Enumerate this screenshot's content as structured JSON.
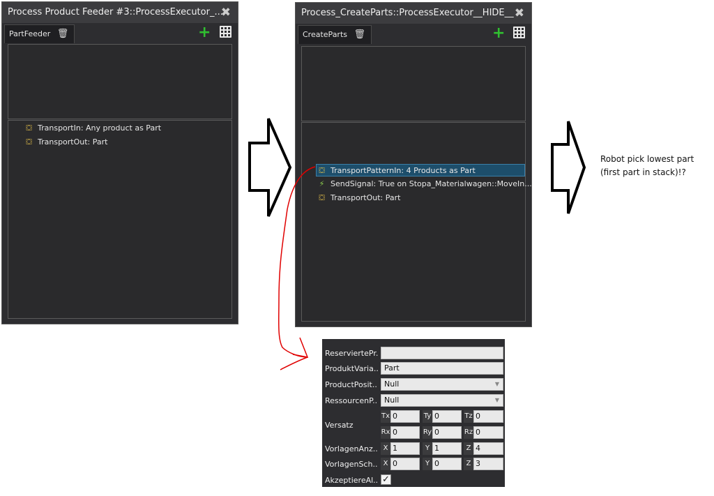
{
  "left_window": {
    "title": "Process Product Feeder #3::ProcessExecutor_...",
    "close": "✖",
    "tab": "PartFeeder",
    "items": [
      {
        "icon": "⛋",
        "label": "TransportIn: Any product as Part"
      },
      {
        "icon": "⛋",
        "label": "TransportOut: Part"
      }
    ]
  },
  "right_window": {
    "title": "Process_CreateParts::ProcessExecutor__HIDE__",
    "close": "✖",
    "tab": "CreateParts",
    "items": [
      {
        "icon": "⛋",
        "label": "TransportPatternIn: 4 Products as Part"
      },
      {
        "icon": "⚡",
        "label": "SendSignal: True on Stopa_Materialwagen::MoveIn..."
      },
      {
        "icon": "⛋",
        "label": "TransportOut: Part"
      }
    ]
  },
  "note": {
    "line1": "Robot pick lowest part",
    "line2": "(first part in stack)!?"
  },
  "properties": {
    "reserviert": {
      "label": "ReserviertePr...",
      "value": ""
    },
    "produktvariante": {
      "label": "ProduktVaria...",
      "value": "Part"
    },
    "productposition": {
      "label": "ProductPosit...",
      "value": "Null"
    },
    "ressourcen": {
      "label": "RessourcenP...",
      "value": "Null"
    },
    "versatz": {
      "label": "Versatz",
      "row1": [
        {
          "axis": "Tx",
          "value": "0"
        },
        {
          "axis": "Ty",
          "value": "0"
        },
        {
          "axis": "Tz",
          "value": "0"
        }
      ],
      "row2": [
        {
          "axis": "Rx",
          "value": "0"
        },
        {
          "axis": "Ry",
          "value": "0"
        },
        {
          "axis": "Rz",
          "value": "0"
        }
      ]
    },
    "vorlagenanzahl": {
      "label": "VorlagenAnz...",
      "cells": [
        {
          "axis": "X",
          "value": "1"
        },
        {
          "axis": "Y",
          "value": "1"
        },
        {
          "axis": "Z",
          "value": "4"
        }
      ]
    },
    "vorlagenschritt": {
      "label": "VorlagenSch...",
      "cells": [
        {
          "axis": "X",
          "value": "0"
        },
        {
          "axis": "Y",
          "value": "0"
        },
        {
          "axis": "Z",
          "value": "3"
        }
      ]
    },
    "akzeptiere": {
      "label": "AkzeptiereAl...",
      "checked": "✓"
    }
  },
  "colors": {
    "accent_plus": "#30c030",
    "selection": "#1d4e6b",
    "annotation": "#e00000"
  }
}
